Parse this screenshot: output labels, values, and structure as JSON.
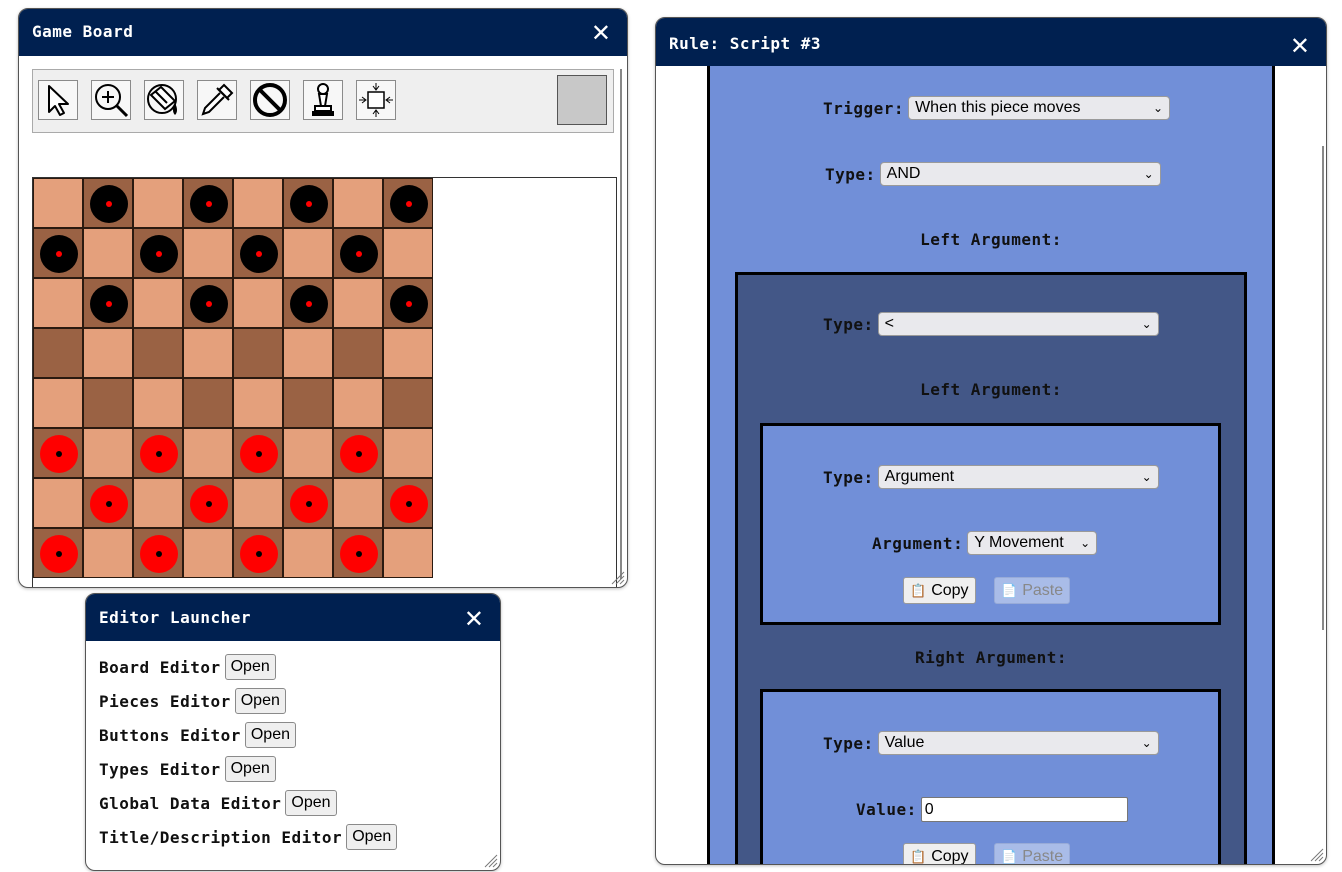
{
  "game_board": {
    "title": "Game Board",
    "close_glyph": "✕",
    "tools": [
      {
        "name": "pointer-icon"
      },
      {
        "name": "zoom-in-icon"
      },
      {
        "name": "paint-bucket-icon"
      },
      {
        "name": "eyedropper-icon"
      },
      {
        "name": "no-entry-icon"
      },
      {
        "name": "pawn-icon"
      },
      {
        "name": "resize-icon"
      }
    ],
    "selected_color": "#c8c8c8",
    "board": {
      "light_color": "#e4a07c",
      "dark_color": "#9a6244",
      "rows": [
        "_B_B_B_B",
        "B_B_B_B_",
        "_B_B_B_B",
        "________",
        "________",
        "R_R_R_R_",
        "_R_R_R_R",
        "R_R_R_R_"
      ],
      "pieces": {
        "B": {
          "fill": "#000000",
          "dot": "#ff0000"
        },
        "R": {
          "fill": "#ff0000",
          "dot": "#000000"
        }
      }
    }
  },
  "editor_launcher": {
    "title": "Editor Launcher",
    "close_glyph": "✕",
    "items": [
      {
        "label": "Board Editor",
        "button": "Open"
      },
      {
        "label": "Pieces Editor",
        "button": "Open"
      },
      {
        "label": "Buttons Editor",
        "button": "Open"
      },
      {
        "label": "Types Editor",
        "button": "Open"
      },
      {
        "label": "Global Data Editor",
        "button": "Open"
      },
      {
        "label": "Title/Description Editor",
        "button": "Open"
      }
    ]
  },
  "rule_script": {
    "title": "Rule: Script #3",
    "close_glyph": "✕",
    "trigger_label": "Trigger:",
    "trigger_value": "When this piece moves",
    "type_label": "Type:",
    "root_type": "AND",
    "left_argument_heading": "Left Argument:",
    "right_argument_heading": "Right Argument:",
    "comparison_type": "<",
    "left_arg": {
      "type": "Argument",
      "argument_label": "Argument:",
      "argument_value": "Y Movement"
    },
    "right_arg": {
      "type": "Value",
      "value_label": "Value:",
      "value": "0"
    },
    "copy_label": "Copy",
    "paste_label": "Paste"
  }
}
